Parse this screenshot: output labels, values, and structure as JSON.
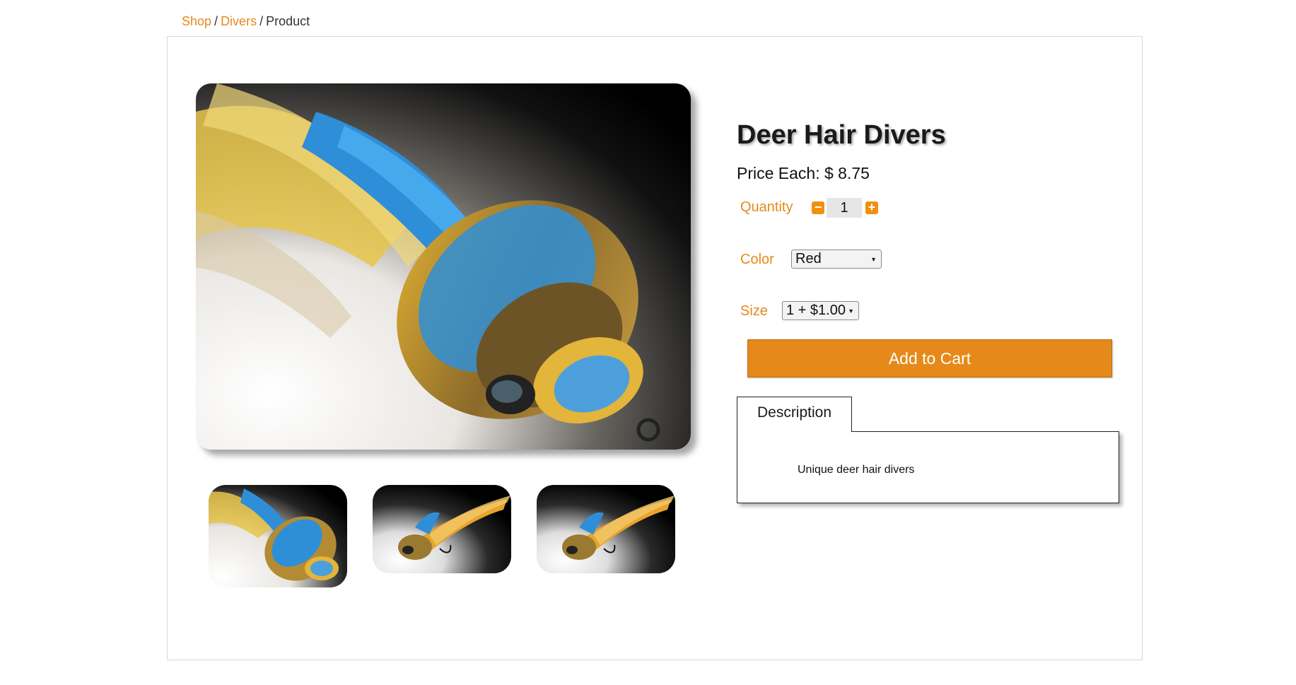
{
  "breadcrumb": {
    "items": [
      "Shop",
      "Divers"
    ],
    "current": "Product",
    "separator": "/"
  },
  "product": {
    "title": "Deer Hair Divers",
    "price_label": "Price Each: $ 8.75",
    "quantity_label": "Quantity",
    "quantity_value": "1",
    "color_label": "Color",
    "color_selected": "Red",
    "size_label": "Size",
    "size_selected": "1 + $1.00",
    "add_to_cart": "Add to Cart"
  },
  "tabs": {
    "description_label": "Description",
    "description_text": "Unique deer hair divers"
  },
  "icons": {
    "minus": "minus-square-icon",
    "plus": "plus-square-icon",
    "dropdown": "dropdown-arrow-icon"
  },
  "colors": {
    "accent": "#e58a1a",
    "text": "#1a1a1a",
    "border": "#d8d8d8"
  }
}
